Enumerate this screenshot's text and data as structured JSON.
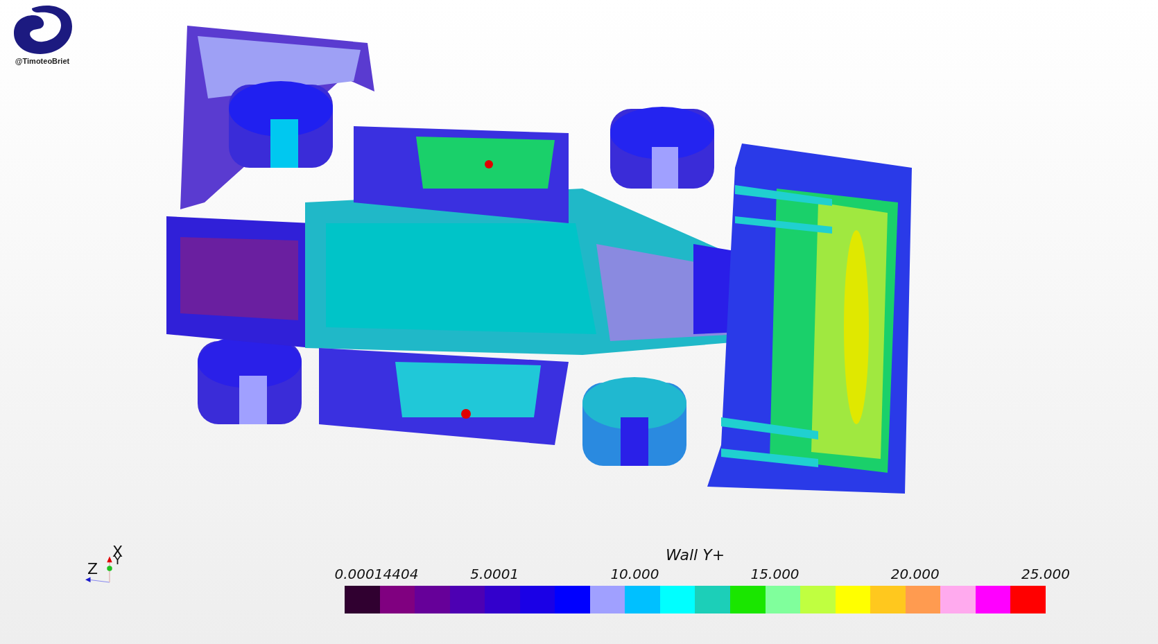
{
  "watermark_free_logo": {
    "handle": "@TimoteoBriet"
  },
  "axes": {
    "x_label": "X",
    "y_label": "Y",
    "z_label": "Z"
  },
  "legend": {
    "title": "Wall Y+",
    "tick_labels": [
      "0.00014404",
      "5.0001",
      "10.000",
      "15.000",
      "20.000",
      "25.000"
    ],
    "swatches": [
      {
        "color": "#300030"
      },
      {
        "color": "#800080"
      },
      {
        "color": "#660099"
      },
      {
        "color": "#4d00b3"
      },
      {
        "color": "#3300cc"
      },
      {
        "color": "#1a00e6"
      },
      {
        "color": "#0000ff"
      },
      {
        "color": "#a0a0ff"
      },
      {
        "color": "#00c0ff"
      },
      {
        "color": "#00ffff"
      },
      {
        "color": "#1ccfb8"
      },
      {
        "color": "#1ae600"
      },
      {
        "color": "#80ff9c"
      },
      {
        "color": "#c0ff40"
      },
      {
        "color": "#ffff00"
      },
      {
        "color": "#ffc81e"
      },
      {
        "color": "#ff9b50"
      },
      {
        "color": "#ffaaee"
      },
      {
        "color": "#ff00ff"
      },
      {
        "color": "#ff0000"
      }
    ]
  }
}
